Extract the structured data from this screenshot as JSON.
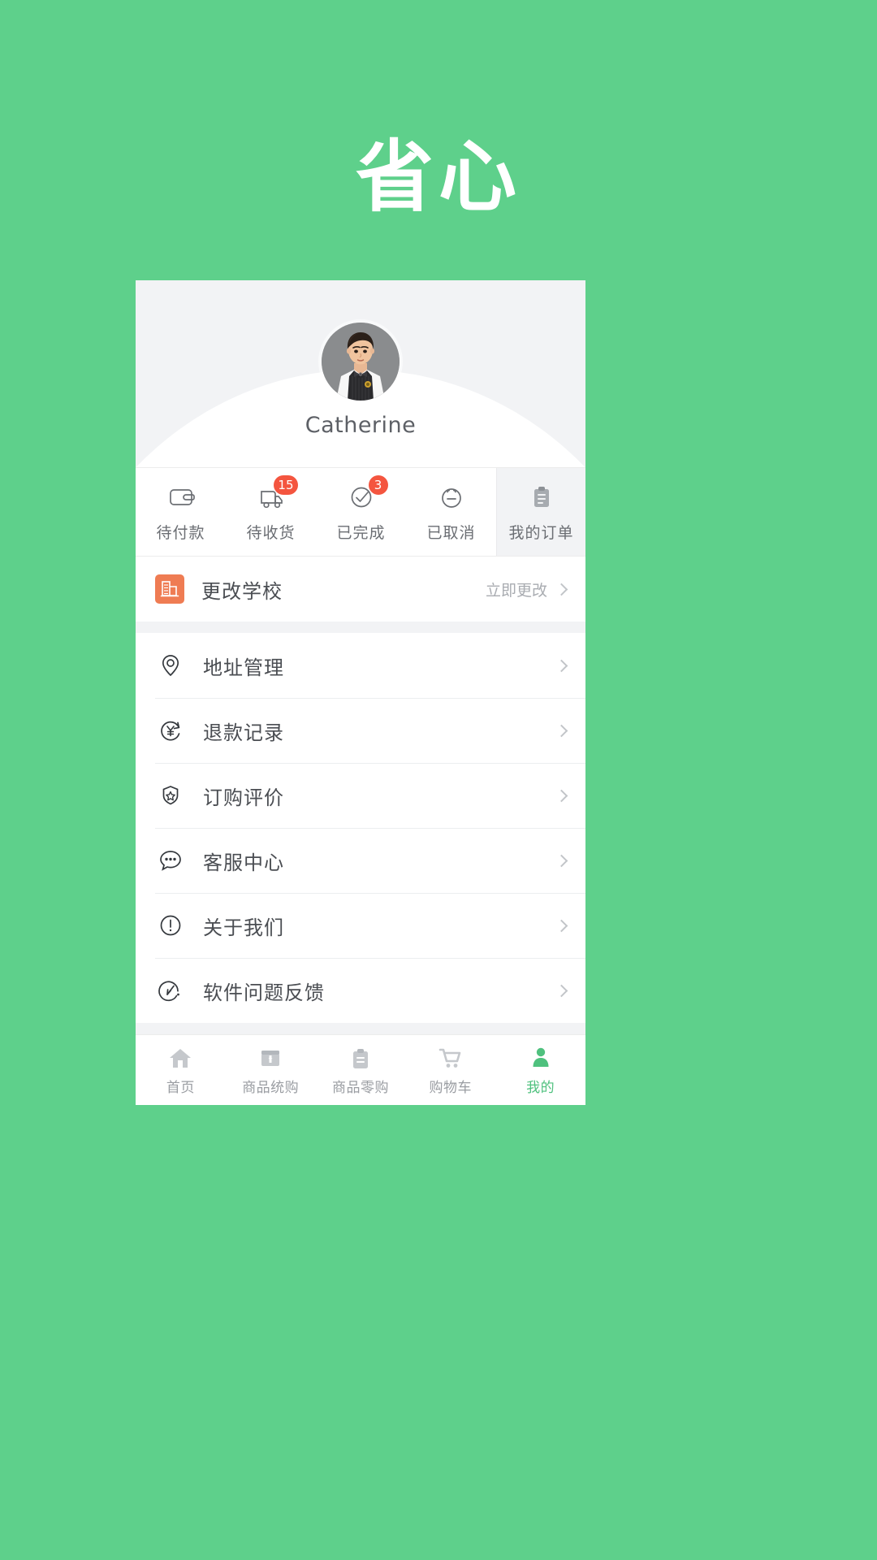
{
  "app": {
    "logo_text": "省心",
    "brand_green": "#5ed08b",
    "accent_green": "#4fc17e",
    "badge_red": "#f4553f",
    "school_icon_orange": "#ef7c53"
  },
  "profile": {
    "username": "Catherine",
    "avatar_icon": "boy-avatar-photo"
  },
  "orders": {
    "tabs": [
      {
        "label": "待付款",
        "icon": "wallet-icon",
        "badge": ""
      },
      {
        "label": "待收货",
        "icon": "truck-icon",
        "badge": "15"
      },
      {
        "label": "已完成",
        "icon": "check-circle-icon",
        "badge": "3"
      },
      {
        "label": "已取消",
        "icon": "neutral-face-icon",
        "badge": ""
      },
      {
        "label": "我的订单",
        "icon": "clipboard-icon",
        "badge": ""
      }
    ]
  },
  "menu": {
    "items": [
      {
        "label": "更改学校",
        "icon": "school-building-icon",
        "action": "立即更改"
      },
      {
        "label": "地址管理",
        "icon": "location-pin-icon",
        "action": ""
      },
      {
        "label": "退款记录",
        "icon": "refund-yuan-icon",
        "action": ""
      },
      {
        "label": "订购评价",
        "icon": "badge-star-icon",
        "action": ""
      },
      {
        "label": "客服中心",
        "icon": "chat-bubble-icon",
        "action": ""
      },
      {
        "label": "关于我们",
        "icon": "info-circle-icon",
        "action": ""
      },
      {
        "label": "软件问题反馈",
        "icon": "feedback-circle-icon",
        "action": ""
      }
    ]
  },
  "tabbar": {
    "items": [
      {
        "label": "首页",
        "icon": "home-icon",
        "active": false
      },
      {
        "label": "商品统购",
        "icon": "group-buy-icon",
        "active": false
      },
      {
        "label": "商品零购",
        "icon": "retail-buy-icon",
        "active": false
      },
      {
        "label": "购物车",
        "icon": "shopping-cart-icon",
        "active": false
      },
      {
        "label": "我的",
        "icon": "person-icon",
        "active": true
      }
    ]
  }
}
